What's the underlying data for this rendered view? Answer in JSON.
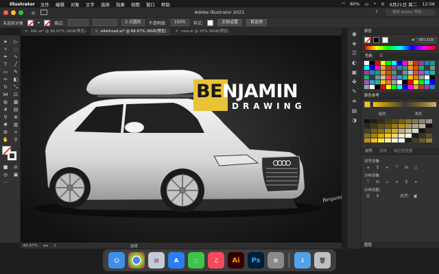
{
  "menubar": {
    "app_name": "Illustrator",
    "items": [
      "文件",
      "编辑",
      "对象",
      "文字",
      "选择",
      "效果",
      "视图",
      "窗口",
      "帮助"
    ],
    "battery": "80%",
    "date": "9月21日 周二",
    "time": "12:56"
  },
  "titlebar": {
    "window_title": "Adobe Illustrator 2021",
    "search_placeholder": "搜索 Adobe 帮助"
  },
  "controlbar": {
    "selection_label": "未选择对象",
    "stroke_label": "描边:",
    "brush_value": "3 点圆形",
    "opacity_label": "不透明度:",
    "opacity_value": "100%",
    "style_label": "样式:",
    "doc_setup_button": "文档设置",
    "preferences_button": "首选项"
  },
  "tabs": [
    {
      "label": "A4L.ai* @ 66.67% (RGB/预览)",
      "active": false
    },
    {
      "label": "a4allroad.ai* @ 66.67% (RGB/预览)",
      "active": true
    },
    {
      "label": "new.ai @ 25% (RGB/预览)",
      "active": false
    }
  ],
  "artwork": {
    "brand_prefix": "BE",
    "brand_rest": "NJAMIN",
    "brand_sub": "DRAWING",
    "signature": "Benjamin"
  },
  "statusbar": {
    "zoom": "66.67%",
    "page": "1",
    "tool": "选择"
  },
  "panels": {
    "color_title": "颜色",
    "hex_label": "#",
    "hex_value": "EEC41B",
    "swatches_title": "色板",
    "swatches_tab2": "库",
    "color_guide_title": "颜色参考",
    "guide_dark": "暗色",
    "guide_light": "浅色",
    "align_tabs": [
      "对齐",
      "变换",
      "路径查找器"
    ],
    "align_objects_label": "对齐对象:",
    "distribute_objects_label": "分布对象:",
    "distribute_spacing_label": "分布间距:",
    "align_to_label": "对齐:",
    "layers_title": "图层"
  },
  "dock": {
    "items": [
      {
        "name": "finder-icon",
        "label": "",
        "color": "#3d8fe8"
      },
      {
        "name": "chrome-icon",
        "label": "",
        "color": "#e8e8e8"
      },
      {
        "name": "launchpad-icon",
        "label": "",
        "color": "#c8c8d8"
      },
      {
        "name": "app-store-icon",
        "label": "",
        "color": "#2a7ef0"
      },
      {
        "name": "wechat-icon",
        "label": "",
        "color": "#3ec44a"
      },
      {
        "name": "music-icon",
        "label": "",
        "color": "#f24a5b"
      },
      {
        "name": "illustrator-icon",
        "label": "Ai",
        "color": "#330000"
      },
      {
        "name": "photoshop-icon",
        "label": "Ps",
        "color": "#001e36"
      },
      {
        "name": "system-preferences-icon",
        "label": "",
        "color": "#8a8a8a"
      },
      {
        "name": "downloads-folder-icon",
        "label": "",
        "color": "#4fa3e8"
      },
      {
        "name": "trash-icon",
        "label": "",
        "color": "#c0c0c0"
      }
    ]
  },
  "colors": {
    "brand_yellow": "#EEC41B"
  }
}
